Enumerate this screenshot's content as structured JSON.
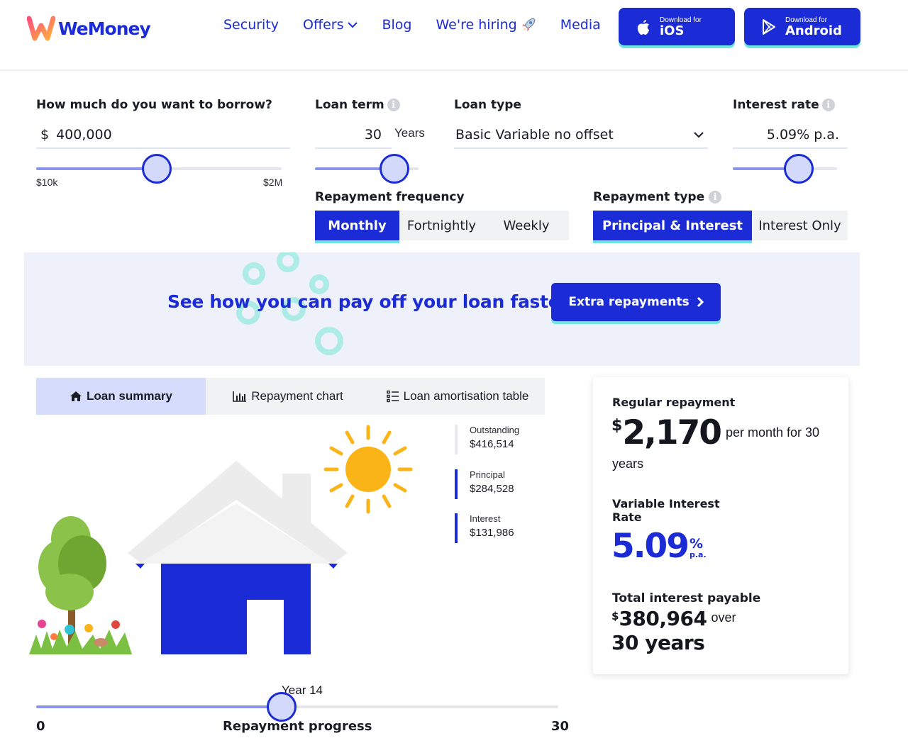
{
  "brand": {
    "name": "WeMoney",
    "accent": "#1b2bd6",
    "highlight": "#6fe5e0"
  },
  "nav": {
    "items": [
      {
        "label": "Security"
      },
      {
        "label": "Offers"
      },
      {
        "label": "Blog"
      },
      {
        "label": "We're hiring"
      },
      {
        "label": "Media"
      }
    ],
    "ios": {
      "small": "Download for",
      "big": "iOS"
    },
    "android": {
      "small": "Download for",
      "big": "Android"
    }
  },
  "borrow": {
    "label": "How much do you want to borrow?",
    "currency": "$",
    "value": "400,000",
    "min_label": "$10k",
    "max_label": "$2M",
    "slider_fraction": 0.49
  },
  "term": {
    "label": "Loan term",
    "value": "30",
    "unit": "Years",
    "slider_fraction": 0.77
  },
  "loan_type": {
    "label": "Loan type",
    "value": "Basic Variable no offset"
  },
  "rate": {
    "label": "Interest rate",
    "value": "5.09% p.a.",
    "slider_fraction": 0.63
  },
  "frequency": {
    "label": "Repayment frequency",
    "options": [
      "Monthly",
      "Fortnightly",
      "Weekly"
    ],
    "selected": "Monthly"
  },
  "repay_type": {
    "label": "Repayment type",
    "options": [
      "Principal & Interest",
      "Interest Only"
    ],
    "selected": "Principal & Interest"
  },
  "banner": {
    "text": "See how you can pay off your loan faster",
    "button": "Extra repayments"
  },
  "tabs": [
    {
      "label": "Loan summary",
      "icon": "home-icon"
    },
    {
      "label": "Repayment chart",
      "icon": "bar-chart-icon"
    },
    {
      "label": "Loan amortisation table",
      "icon": "list-icon"
    }
  ],
  "stats": [
    {
      "label": "Outstanding",
      "value": "$416,514"
    },
    {
      "label": "Principal",
      "value": "$284,528"
    },
    {
      "label": "Interest",
      "value": "$131,986"
    }
  ],
  "summary": {
    "regular_title": "Regular repayment",
    "regular_symbol": "$",
    "regular_amount": "2,170",
    "regular_suffix": "per month for 30",
    "regular_suffix2": "years",
    "rate_title_1": "Variable Interest",
    "rate_title_2": "Rate",
    "rate_value": "5.09",
    "rate_pct": "%",
    "rate_pa": "p.a.",
    "total_title": "Total interest payable",
    "total_symbol": "$",
    "total_amount": "380,964",
    "total_over": "over",
    "total_years": "30 years"
  },
  "progress": {
    "year_label": "Year 14",
    "min": "0",
    "max": "30",
    "label": "Repayment progress",
    "fraction": 0.47
  }
}
